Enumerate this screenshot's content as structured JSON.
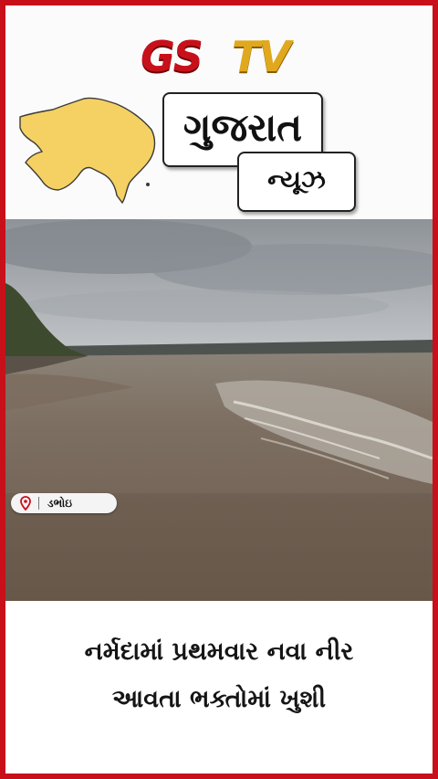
{
  "brand": {
    "logo_left": "GS",
    "logo_right": "TV",
    "red": "#c8101a",
    "gold": "#e0a81c"
  },
  "header": {
    "title": "ગુજરાત",
    "subtitle": "ન્યૂઝ",
    "map_icon": "gujarat-map-icon"
  },
  "location": {
    "label": "ડભોઇ",
    "icon": "location-pin-icon"
  },
  "caption": {
    "line1": "નર્મદામાં પ્રથમવાર નવા નીર",
    "line2": "આવતા ભક્તોમાં ખુશી"
  }
}
